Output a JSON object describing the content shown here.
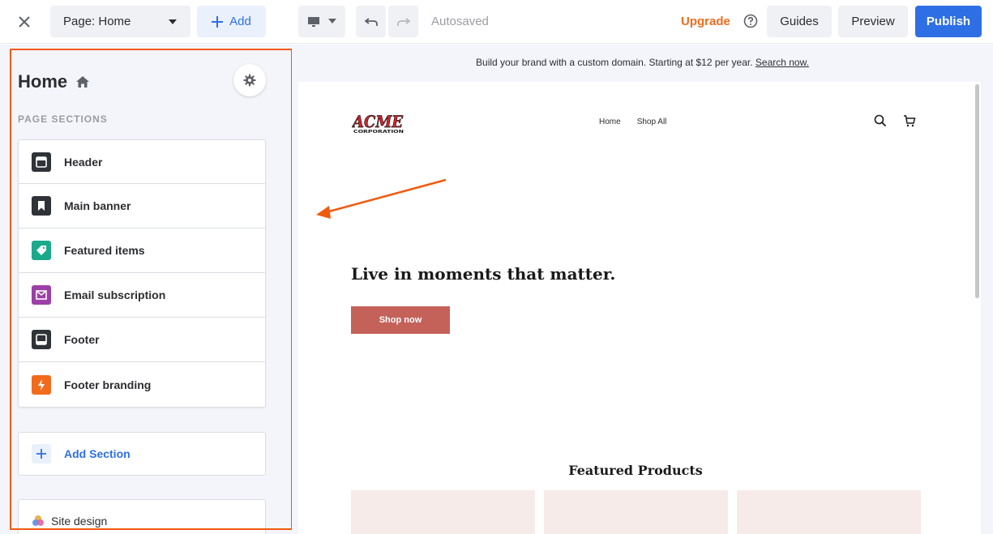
{
  "toolbar": {
    "page_select_label": "Page: Home",
    "add_label": "Add",
    "autosaved_label": "Autosaved",
    "upgrade_label": "Upgrade",
    "guides_label": "Guides",
    "preview_label": "Preview",
    "publish_label": "Publish"
  },
  "panel": {
    "title": "Home",
    "sections_label": "PAGE SECTIONS",
    "sections": [
      {
        "label": "Header",
        "icon": "header-icon",
        "color": "#2f3237"
      },
      {
        "label": "Main banner",
        "icon": "bookmark-icon",
        "color": "#2f3237"
      },
      {
        "label": "Featured items",
        "icon": "tag-icon",
        "color": "#1aa98b"
      },
      {
        "label": "Email subscription",
        "icon": "mail-icon",
        "color": "#9c3fa6"
      },
      {
        "label": "Footer",
        "icon": "footer-icon",
        "color": "#2f3237"
      },
      {
        "label": "Footer branding",
        "icon": "bolt-icon",
        "color": "#f26b1d"
      }
    ],
    "add_section_label": "Add Section",
    "site_design_label": "Site design"
  },
  "canvas": {
    "promo_text": "Build your brand with a custom domain. Starting at $12 per year.",
    "promo_link": "Search now.",
    "logo_text": "ACME",
    "logo_subtext": "CORPORATION",
    "nav": [
      "Home",
      "Shop All"
    ],
    "hero_text": "Live in moments that matter.",
    "shop_button": "Shop now",
    "featured_title": "Featured Products"
  },
  "colors": {
    "accent": "#2e6fe6",
    "highlight": "#f05a0e",
    "upgrade": "#f26b1d",
    "shop_button": "#c4625a"
  }
}
